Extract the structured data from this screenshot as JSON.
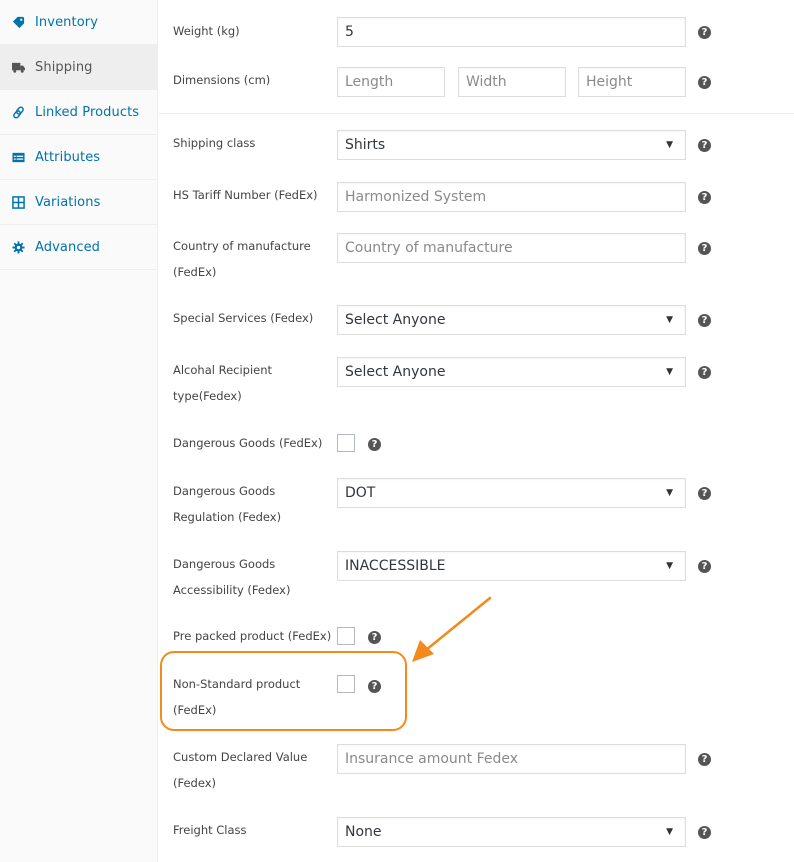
{
  "sidebar": {
    "items": [
      {
        "label": "Inventory",
        "icon": "tag-icon",
        "active": false
      },
      {
        "label": "Shipping",
        "icon": "truck-icon",
        "active": true
      },
      {
        "label": "Linked Products",
        "icon": "link-icon",
        "active": false
      },
      {
        "label": "Attributes",
        "icon": "list-card-icon",
        "active": false
      },
      {
        "label": "Variations",
        "icon": "grid-icon",
        "active": false
      },
      {
        "label": "Advanced",
        "icon": "gear-icon",
        "active": false
      }
    ]
  },
  "form": {
    "weight": {
      "label": "Weight (kg)",
      "value": "5"
    },
    "dimensions": {
      "label": "Dimensions (cm)",
      "length_placeholder": "Length",
      "width_placeholder": "Width",
      "height_placeholder": "Height"
    },
    "shipping_class": {
      "label": "Shipping class",
      "value": "Shirts"
    },
    "hs_tariff": {
      "label": "HS Tariff Number (FedEx)",
      "placeholder": "Harmonized System"
    },
    "country": {
      "label_line1": "Country of manufacture",
      "label_line2": "(FedEx)",
      "placeholder": "Country of manufacture"
    },
    "special_services": {
      "label": "Special Services (Fedex)",
      "value": "Select Anyone"
    },
    "alcohol": {
      "label_line1": "Alcohal Recipient",
      "label_line2": "type(Fedex)",
      "value": "Select Anyone"
    },
    "dangerous_goods": {
      "label": "Dangerous Goods (FedEx)",
      "checked": false
    },
    "dg_regulation": {
      "label_line1": "Dangerous Goods",
      "label_line2": "Regulation (Fedex)",
      "value": "DOT"
    },
    "dg_accessibility": {
      "label_line1": "Dangerous Goods",
      "label_line2": "Accessibility (Fedex)",
      "value": "INACCESSIBLE"
    },
    "pre_packed": {
      "label": "Pre packed product (FedEx)",
      "checked": false
    },
    "non_standard": {
      "label_line1": "Non-Standard product",
      "label_line2": "(FedEx)",
      "checked": false
    },
    "declared_value": {
      "label_line1": "Custom Declared Value",
      "label_line2": "(Fedex)",
      "placeholder": "Insurance amount Fedex"
    },
    "freight_class": {
      "label": "Freight Class",
      "value": "None"
    }
  },
  "help_glyph": "?",
  "caret_glyph": "▼",
  "annotation": {
    "color": "#f28a1c"
  }
}
